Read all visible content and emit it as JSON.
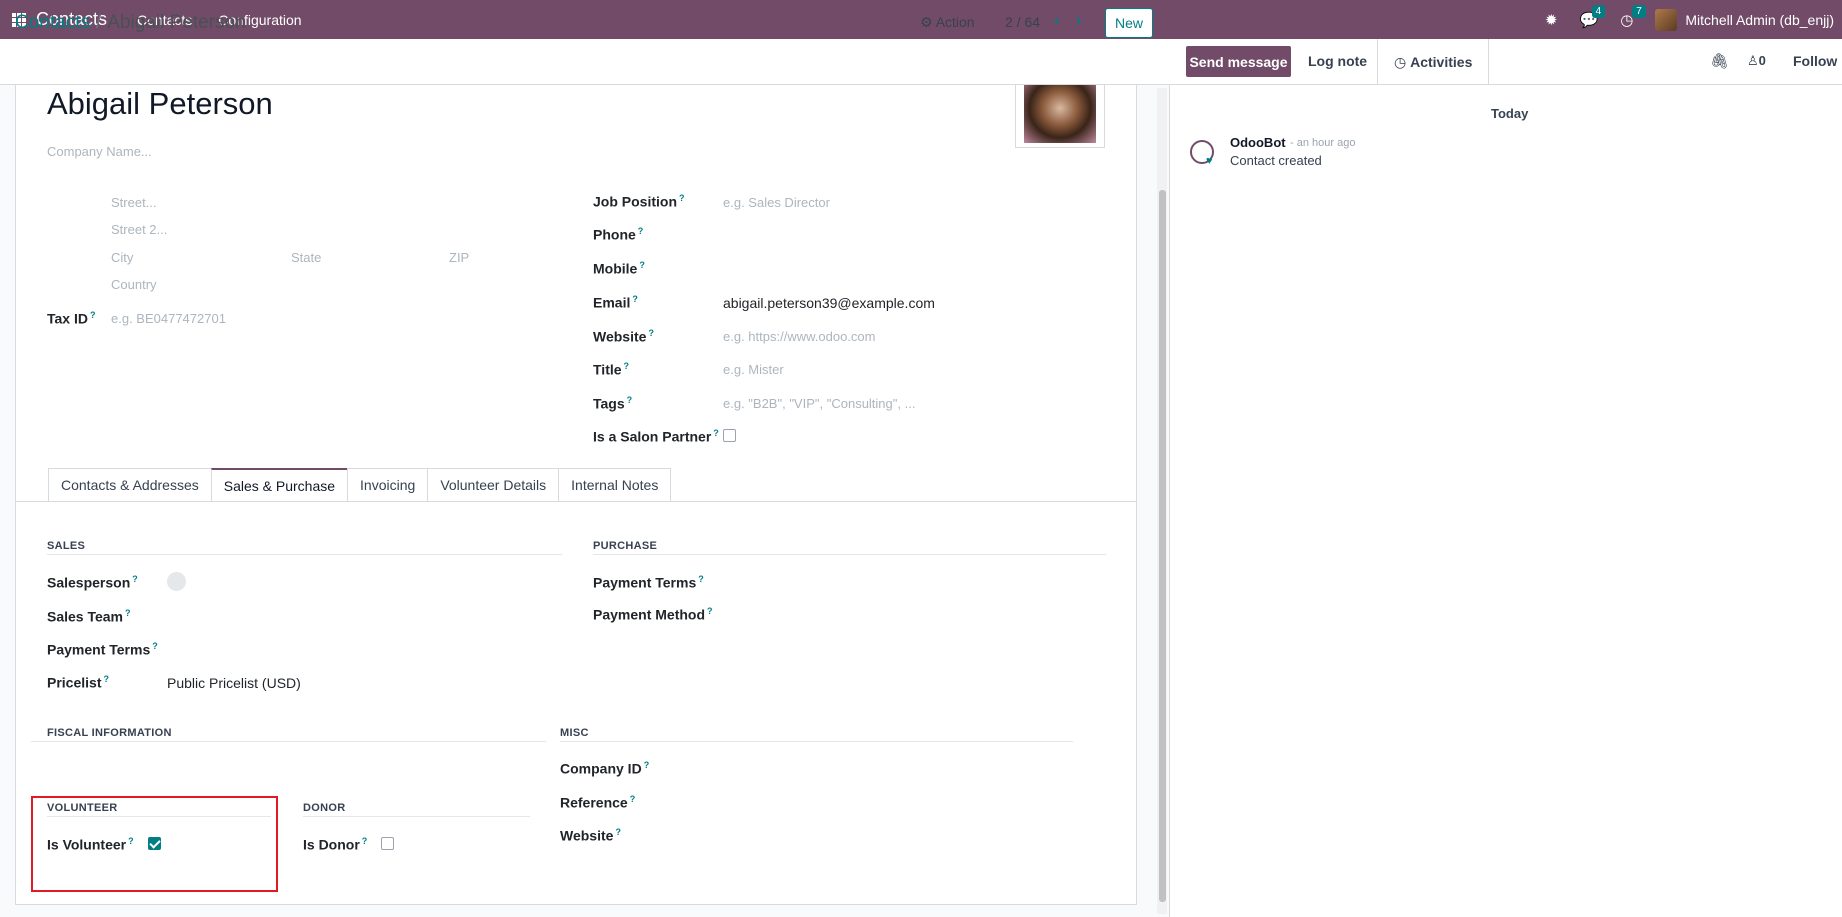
{
  "navbar": {
    "app_name": "Contacts",
    "menu": [
      "Contacts",
      "Configuration"
    ],
    "messages_count": "4",
    "activities_count": "7",
    "user": "Mitchell Admin (db_enjj)"
  },
  "control_panel": {
    "breadcrumb_parent": "Contacts",
    "breadcrumb_sep": "/",
    "breadcrumb_current": "Abigail Peterson",
    "action_label": "Action",
    "pager": "2 / 64",
    "new_label": "New"
  },
  "form": {
    "name": "Abigail Peterson",
    "company_placeholder": "Company Name...",
    "address": {
      "street": "Street...",
      "street2": "Street 2...",
      "city": "City",
      "state": "State",
      "zip": "ZIP",
      "country": "Country"
    },
    "tax_id_label": "Tax ID",
    "tax_id_placeholder": "e.g. BE0477472701",
    "right_fields": {
      "job_position_label": "Job Position",
      "job_position_placeholder": "e.g. Sales Director",
      "phone_label": "Phone",
      "mobile_label": "Mobile",
      "email_label": "Email",
      "email_value": "abigail.peterson39@example.com",
      "website_label": "Website",
      "website_placeholder": "e.g. https://www.odoo.com",
      "title_label": "Title",
      "title_placeholder": "e.g. Mister",
      "tags_label": "Tags",
      "tags_placeholder": "e.g. \"B2B\", \"VIP\", \"Consulting\", ...",
      "salon_partner_label": "Is a Salon Partner"
    },
    "help_mark": "?",
    "tabs": [
      "Contacts & Addresses",
      "Sales & Purchase",
      "Invoicing",
      "Volunteer Details",
      "Internal Notes"
    ],
    "active_tab": "Sales & Purchase",
    "sales": {
      "title": "SALES",
      "salesperson_label": "Salesperson",
      "sales_team_label": "Sales Team",
      "payment_terms_label": "Payment Terms",
      "pricelist_label": "Pricelist",
      "pricelist_value": "Public Pricelist (USD)"
    },
    "purchase": {
      "title": "PURCHASE",
      "payment_terms_label": "Payment Terms",
      "payment_method_label": "Payment Method"
    },
    "fiscal": {
      "title": "FISCAL INFORMATION"
    },
    "misc": {
      "title": "MISC",
      "company_id_label": "Company ID",
      "reference_label": "Reference",
      "website_label": "Website"
    },
    "volunteer": {
      "title": "VOLUNTEER",
      "is_volunteer_label": "Is Volunteer",
      "is_volunteer": true
    },
    "donor": {
      "title": "DONOR",
      "is_donor_label": "Is Donor",
      "is_donor": false
    }
  },
  "chatter": {
    "send_message": "Send message",
    "log_note": "Log note",
    "activities": "Activities",
    "followers_count": "0",
    "follow": "Follow",
    "date_separator": "Today",
    "message": {
      "author": "OdooBot",
      "time": "- an hour ago",
      "body": "Contact created"
    }
  },
  "colors": {
    "brand": "#714b67",
    "accent": "#017e84",
    "highlight": "#e01b24"
  }
}
